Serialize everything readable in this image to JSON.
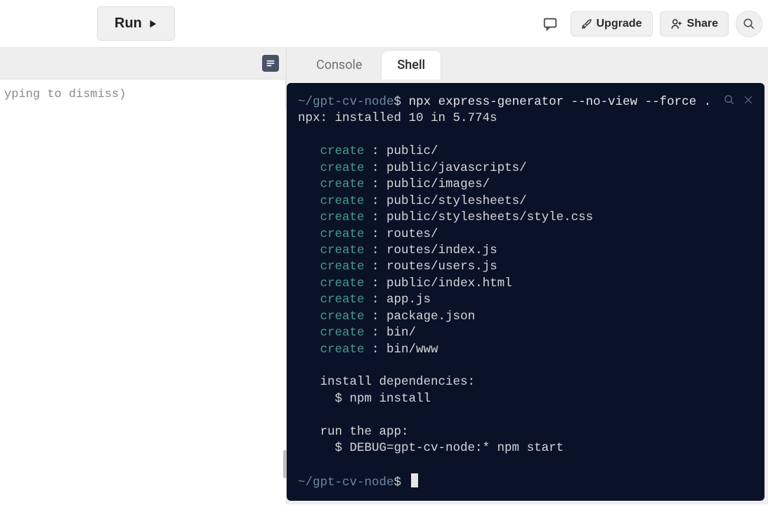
{
  "toolbar": {
    "run_label": "Run",
    "upgrade_label": "Upgrade",
    "share_label": "Share"
  },
  "editor": {
    "hint_text": "yping to dismiss)"
  },
  "tabs": {
    "console_label": "Console",
    "shell_label": "Shell",
    "active": "Shell"
  },
  "terminal": {
    "prompt_path": "~/gpt-cv-node",
    "prompt_suffix": "$",
    "command": "npx express-generator --no-view --force .",
    "npx_line": "npx: installed 10 in 5.774s",
    "create_label": "create",
    "creates": [
      "public/",
      "public/javascripts/",
      "public/images/",
      "public/stylesheets/",
      "public/stylesheets/style.css",
      "routes/",
      "routes/index.js",
      "routes/users.js",
      "public/index.html",
      "app.js",
      "package.json",
      "bin/",
      "bin/www"
    ],
    "install_heading": "install dependencies:",
    "install_cmd": "  $ npm install",
    "run_heading": "run the app:",
    "run_cmd": "  $ DEBUG=gpt-cv-node:* npm start"
  }
}
